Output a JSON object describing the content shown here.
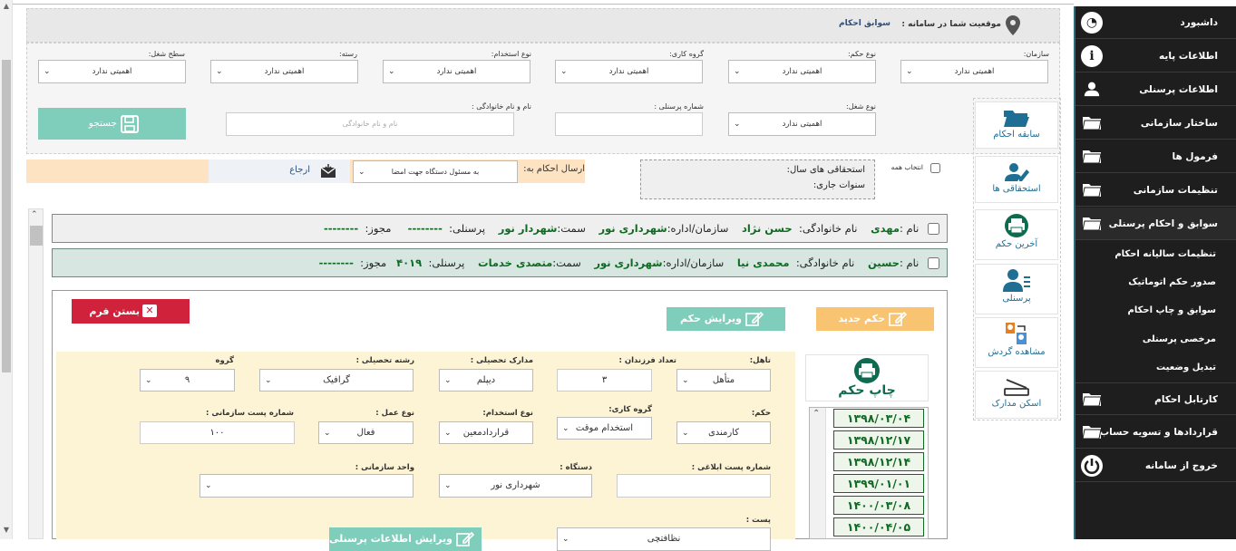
{
  "sidebar": {
    "items": [
      {
        "label": "داشبورد",
        "icon": "dashboard-icon"
      },
      {
        "label": "اطلاعات پایه",
        "icon": "info-icon"
      },
      {
        "label": "اطلاعات پرسنلی",
        "icon": "user-icon"
      },
      {
        "label": "ساختار سازمانی",
        "icon": "folder-icon"
      },
      {
        "label": "فرمول ها",
        "icon": "folder-icon"
      },
      {
        "label": "تنظیمات سازمانی",
        "icon": "folder-icon"
      },
      {
        "label": "سوابق و احکام پرسنلی",
        "icon": "folder-icon"
      }
    ],
    "subitems": [
      "تنظیمات سالیانه احکام",
      "صدور حکم اتوماتیک",
      "سوابق و چاپ احکام",
      "مرخصی پرسنلی",
      "تبدیل وضعیت"
    ],
    "bottom_items": [
      {
        "label": "کارتابل احکام",
        "icon": "folder-icon"
      },
      {
        "label": "قراردادها و تسویه حساب",
        "icon": "folder-icon"
      },
      {
        "label": "خروج از سامانه",
        "icon": "power-icon"
      }
    ]
  },
  "header": {
    "location_label": "موقعیت شما در سامانه :",
    "location_value": "سوابق احکام"
  },
  "filters": {
    "row1": [
      {
        "label": "سازمان:",
        "value": "اهمیتی ندارد"
      },
      {
        "label": "نوع حکم:",
        "value": "اهمیتی ندارد"
      },
      {
        "label": "گروه کاری:",
        "value": "اهمیتی ندارد"
      },
      {
        "label": "نوع استخدام:",
        "value": "اهمیتی ندارد"
      },
      {
        "label": "رسته:",
        "value": "اهمیتی ندارد"
      },
      {
        "label": "سطح شغل:",
        "value": "اهمیتی ندارد"
      }
    ],
    "job_type_label": "نوع شغل:",
    "job_type_value": "اهمیتی ندارد",
    "personnel_no_label": "شماره پرسنلی :",
    "name_label": "نام و نام خانوادگی :",
    "name_placeholder": "نام و نام خانوادگی",
    "search_label": "جستجو"
  },
  "send": {
    "label": "ارسال احکام به:",
    "value": "به مسئول دستگاه جهت امضا",
    "refer": "ارجاع",
    "select_all": "انتخاب همه",
    "entitlement_year": "استحقاقی های سال:",
    "current_years": "سنوات جاری:"
  },
  "tiles": [
    "سابقه احکام",
    "استحقاقی ها",
    "آخرین حکم",
    "پرسنلی",
    "مشاهده گردش",
    "اسکن مدارک"
  ],
  "persons": [
    {
      "name_label": "نام :",
      "name": "مهدی",
      "family_label": "نام خانوادگی:",
      "family": "حسن نژاد",
      "org_label": "سازمان/اداره:",
      "org": "شهرداری نور",
      "post_label": "سمت:",
      "post": "شهردار نور",
      "personnel_label": "پرسنلی:",
      "personnel": "--------",
      "permit_label": "مجوز:",
      "permit": "--------"
    },
    {
      "name_label": "نام :",
      "name": "حسین",
      "family_label": "نام خانوادگی:",
      "family": "محمدی نیا",
      "org_label": "سازمان/اداره:",
      "org": "شهرداری نور",
      "post_label": "سمت:",
      "post": "متصدی خدمات",
      "personnel_label": "پرسنلی:",
      "personnel": "۴۰۱۹",
      "permit_label": "مجوز:",
      "permit": "--------"
    }
  ],
  "form": {
    "close": "بستن فرم",
    "edit": "ویرایش حکم",
    "new": "حکم جدید",
    "print": "چاپ حکم",
    "marital_label": "تاهل:",
    "marital": "متأهل",
    "children_label": "تعداد فرزندان :",
    "children": "۳",
    "education_label": "مدارک تحصیلی :",
    "education": "دیپلم",
    "field_label": "رشته تحصیلی :",
    "field": "گرافیک",
    "group_label": "گروه",
    "group": "۹",
    "decree_label": "حکم:",
    "decree": "کارمندی",
    "workgroup_label": "گروه کاری:",
    "workgroup": "استخدام موقت",
    "employment_label": "نوع استخدام:",
    "employment": "قراردادمعین",
    "worktype_label": "نوع عمل :",
    "worktype": "فعال",
    "orgpost_label": "شماره پست سازمانی :",
    "orgpost": "۱۰۰",
    "notify_label": "شماره پست ابلاغی :",
    "device_label": "دستگاه :",
    "device": "شهرداری نور",
    "unit_label": "واحد سازمانی :",
    "post_label": "پست :",
    "post": "نظافتچی",
    "edit_personnel": "ویرایش اطلاعات پرسنلی"
  },
  "dates": [
    "۱۳۹۸/۰۳/۰۴",
    "۱۳۹۸/۱۲/۱۷",
    "۱۳۹۸/۱۲/۱۴",
    "۱۳۹۹/۰۱/۰۱",
    "۱۴۰۰/۰۳/۰۸",
    "۱۴۰۰/۰۴/۰۵"
  ],
  "colors": {
    "sidebar": "#1e1e1e",
    "teal": "#7fcdbb",
    "orange": "#f8c471",
    "red": "#d0233b",
    "green": "#0f6b22"
  }
}
